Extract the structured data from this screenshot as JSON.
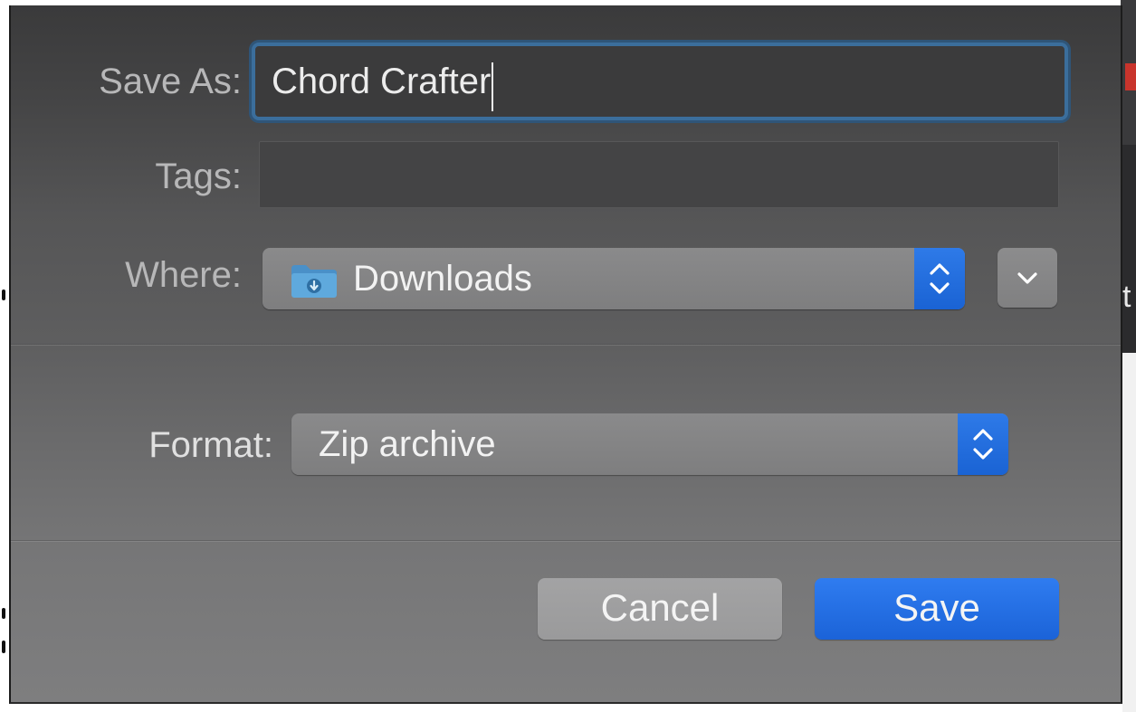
{
  "dialog": {
    "save_as": {
      "label": "Save As:",
      "value": "Chord Crafter"
    },
    "tags": {
      "label": "Tags:",
      "value": ""
    },
    "where": {
      "label": "Where:",
      "selected": "Downloads",
      "icon": "downloads-folder-icon"
    },
    "format": {
      "label": "Format:",
      "selected": "Zip archive"
    },
    "buttons": {
      "cancel_label": "Cancel",
      "save_label": "Save"
    }
  },
  "background_app": {
    "visible_letter": "t"
  },
  "colors": {
    "accent": "#1b63d8",
    "focus_ring": "#3b6e9c",
    "folder_blue": "#5fa9dd"
  }
}
